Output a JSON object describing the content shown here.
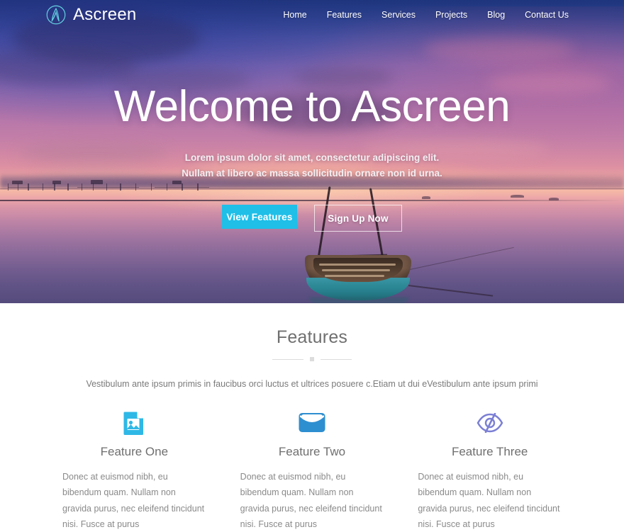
{
  "brand": {
    "name": "Ascreen",
    "logo_icon": "circle-a-logo-icon",
    "logo_color": "#5fd0e0"
  },
  "nav": {
    "items": [
      {
        "label": "Home"
      },
      {
        "label": "Features"
      },
      {
        "label": "Services"
      },
      {
        "label": "Projects"
      },
      {
        "label": "Blog"
      },
      {
        "label": "Contact Us"
      }
    ]
  },
  "hero": {
    "title": "Welcome to Ascreen",
    "subtitle": "Lorem ipsum dolor sit amet, consectetur adipiscing elit. Nullam at libero ac massa sollicitudin ornare non id urna.",
    "primary_button": "View Features",
    "secondary_button": "Sign Up Now",
    "primary_button_color": "#1fbfe8",
    "background": "sunset-lake-boat-photo"
  },
  "features_section": {
    "title": "Features",
    "description": "Vestibulum ante ipsum primis in faucibus orci luctus et ultrices posuere c.Etiam ut dui eVestibulum ante ipsum primi",
    "items": [
      {
        "icon": "image-file-icon",
        "icon_color": "#2fb8e6",
        "title": "Feature One",
        "text": "Donec at euismod nibh, eu bibendum quam. Nullam non gravida purus, nec eleifend tincidunt nisi. Fusce at purus"
      },
      {
        "icon": "envelope-icon",
        "icon_color": "#2e8fd0",
        "title": "Feature Two",
        "text": "Donec at euismod nibh, eu bibendum quam. Nullam non gravida purus, nec eleifend tincidunt nisi. Fusce at purus"
      },
      {
        "icon": "eye-slash-icon",
        "icon_color": "#7b7fd4",
        "title": "Feature Three",
        "text": "Donec at euismod nibh, eu bibendum quam. Nullam non gravida purus, nec eleifend tincidunt nisi. Fusce at purus"
      }
    ]
  }
}
